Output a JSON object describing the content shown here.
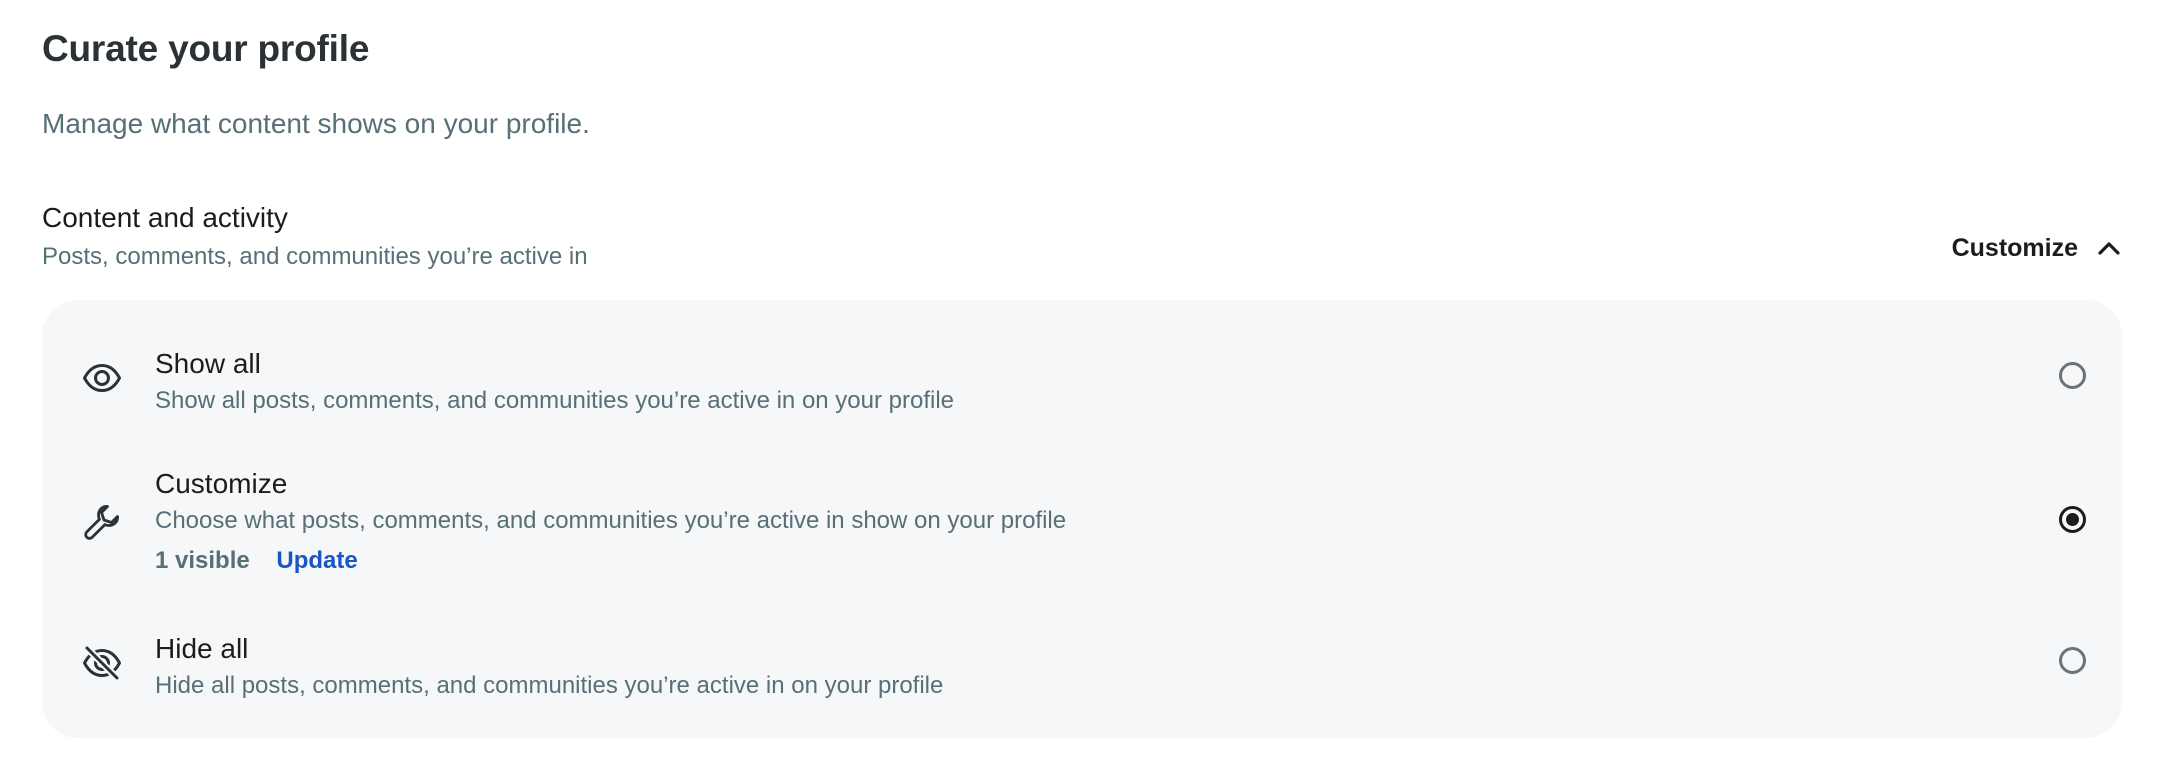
{
  "page": {
    "title": "Curate your profile",
    "subtitle": "Manage what content shows on your profile."
  },
  "section": {
    "title": "Content and activity",
    "description": "Posts, comments, and communities you’re active in",
    "toggle_label": "Customize",
    "toggle_icon": "chevron-up-icon",
    "expanded": true
  },
  "options": [
    {
      "icon": "eye-icon",
      "title": "Show all",
      "description": "Show all posts, comments, and communities you’re active in on your profile",
      "selected": false
    },
    {
      "icon": "wrench-icon",
      "title": "Customize",
      "description": "Choose what posts, comments, and communities you’re active in show on your profile",
      "visible_count": "1 visible",
      "update_label": "Update",
      "selected": true
    },
    {
      "icon": "eye-off-icon",
      "title": "Hide all",
      "description": "Hide all posts, comments, and communities you’re active in on your profile",
      "selected": false
    }
  ],
  "colors": {
    "panel_background": "#f5f7f8",
    "muted_text": "#576f76",
    "link": "#1a55c5",
    "primary_text": "#1c1c1c"
  }
}
